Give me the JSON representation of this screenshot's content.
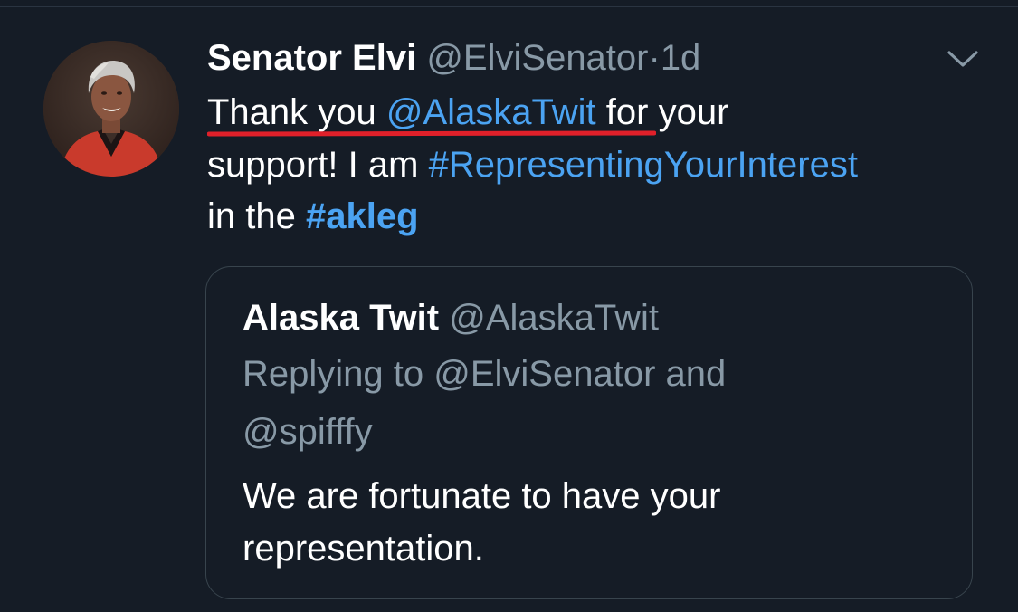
{
  "tweet": {
    "display_name": "Senator Elvi",
    "handle": "@ElviSenator",
    "separator": "·",
    "time": "1d",
    "text": {
      "line1_prefix": "Thank you ",
      "line1_mention": "@AlaskaTwit",
      "line1_suffix": " for your",
      "line2_prefix": "support! I am ",
      "line2_hashtag": "#RepresentingYourInterest",
      "line3_prefix": "in the ",
      "line3_hashtag": "#akleg"
    },
    "menu_icon": "chevron-down-icon",
    "avatar": "profile-photo"
  },
  "quoted": {
    "display_name": "Alaska Twit",
    "handle": "@AlaskaTwit",
    "replying_line1": "Replying to @ElviSenator and",
    "replying_line2": "@spifffy",
    "body_line1": "We are fortunate to have your",
    "body_line2": "representation."
  },
  "annotation": {
    "type": "red underline",
    "color": "#e0202a"
  },
  "colors": {
    "background": "#151c26",
    "primary_text": "#ffffff",
    "secondary_text": "#8899a6",
    "link": "#4ba3f2",
    "card_border": "#38444d"
  }
}
